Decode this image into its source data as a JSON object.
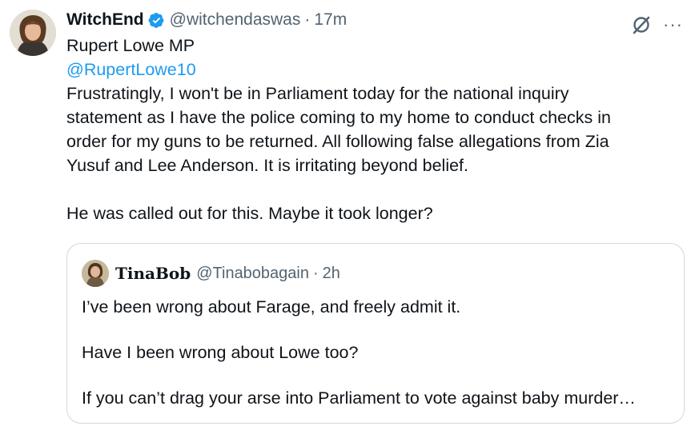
{
  "tweet": {
    "author": {
      "display_name": "WitchEnd",
      "handle": "@witchendaswas",
      "separator": "·",
      "time": "17m",
      "verified": true,
      "avatar_icon": "profile-photo"
    },
    "actions": {
      "grok_icon": "grok-icon",
      "more_icon": "more-icon",
      "more_label": "···"
    },
    "text": {
      "line1": "Rupert Lowe MP",
      "mention": "@RupertLowe10",
      "line3": "Frustratingly, I won't be in Parliament today for the national inquiry",
      "line4": "statement as I have the police coming to my home to conduct checks in",
      "line5": "order for my guns to be returned.  All following false allegations from Zia",
      "line6": "Yusuf and Lee Anderson.  It is irritating beyond belief.",
      "line7": "He was called out for this. Maybe it took longer?"
    },
    "quote": {
      "display_name": "TinaBob",
      "handle": "@Tinabobagain",
      "separator": "·",
      "time": "2h",
      "avatar_icon": "profile-photo",
      "line1": "I’ve been wrong about Farage, and freely admit it.",
      "line2": "Have I been wrong about Lowe too?",
      "line3": "If you can’t drag your arse into Parliament to vote against baby murder…"
    }
  },
  "colors": {
    "text": "#0f1419",
    "secondary": "#536471",
    "link": "#1d9bf0",
    "border": "#cfd9de",
    "verified": "#1d9bf0"
  }
}
